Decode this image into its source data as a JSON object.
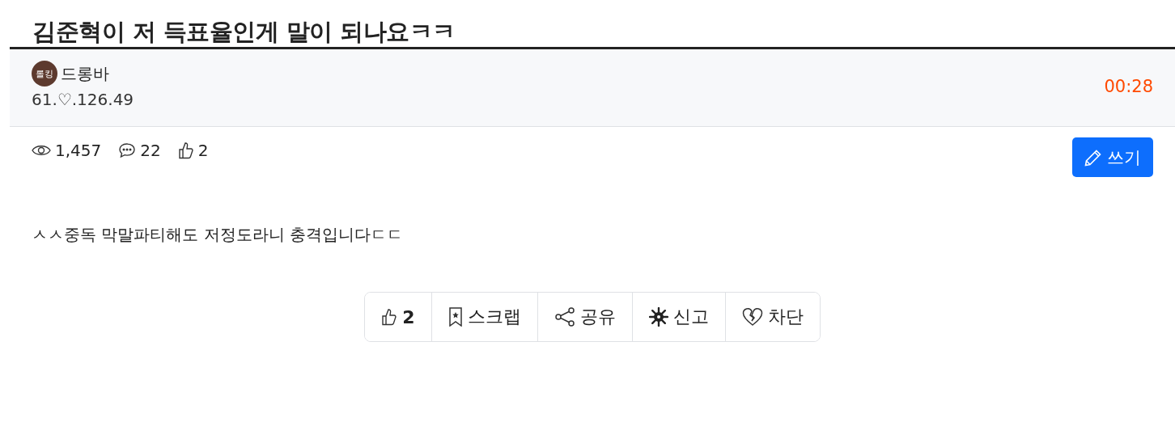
{
  "title": "김준혁이 저 득표율인게 말이 되나요ㅋㅋ",
  "author": {
    "badge": "롤킹",
    "name": "드롱바",
    "ip": "61.♡.126.49"
  },
  "time": "00:28",
  "stats": [
    {
      "kind": "views",
      "value": "1,457"
    },
    {
      "kind": "comments",
      "value": "22"
    },
    {
      "kind": "likes",
      "value": "2"
    }
  ],
  "write_button": "쓰기",
  "body": "ㅅㅅ중독 막말파티해도 저정도라니 충격입니다ㄷㄷ",
  "actions": [
    {
      "kind": "like",
      "label": "2"
    },
    {
      "kind": "scrap",
      "label": "스크랩"
    },
    {
      "kind": "share",
      "label": "공유"
    },
    {
      "kind": "report",
      "label": "신고"
    },
    {
      "kind": "block",
      "label": "차단"
    }
  ]
}
